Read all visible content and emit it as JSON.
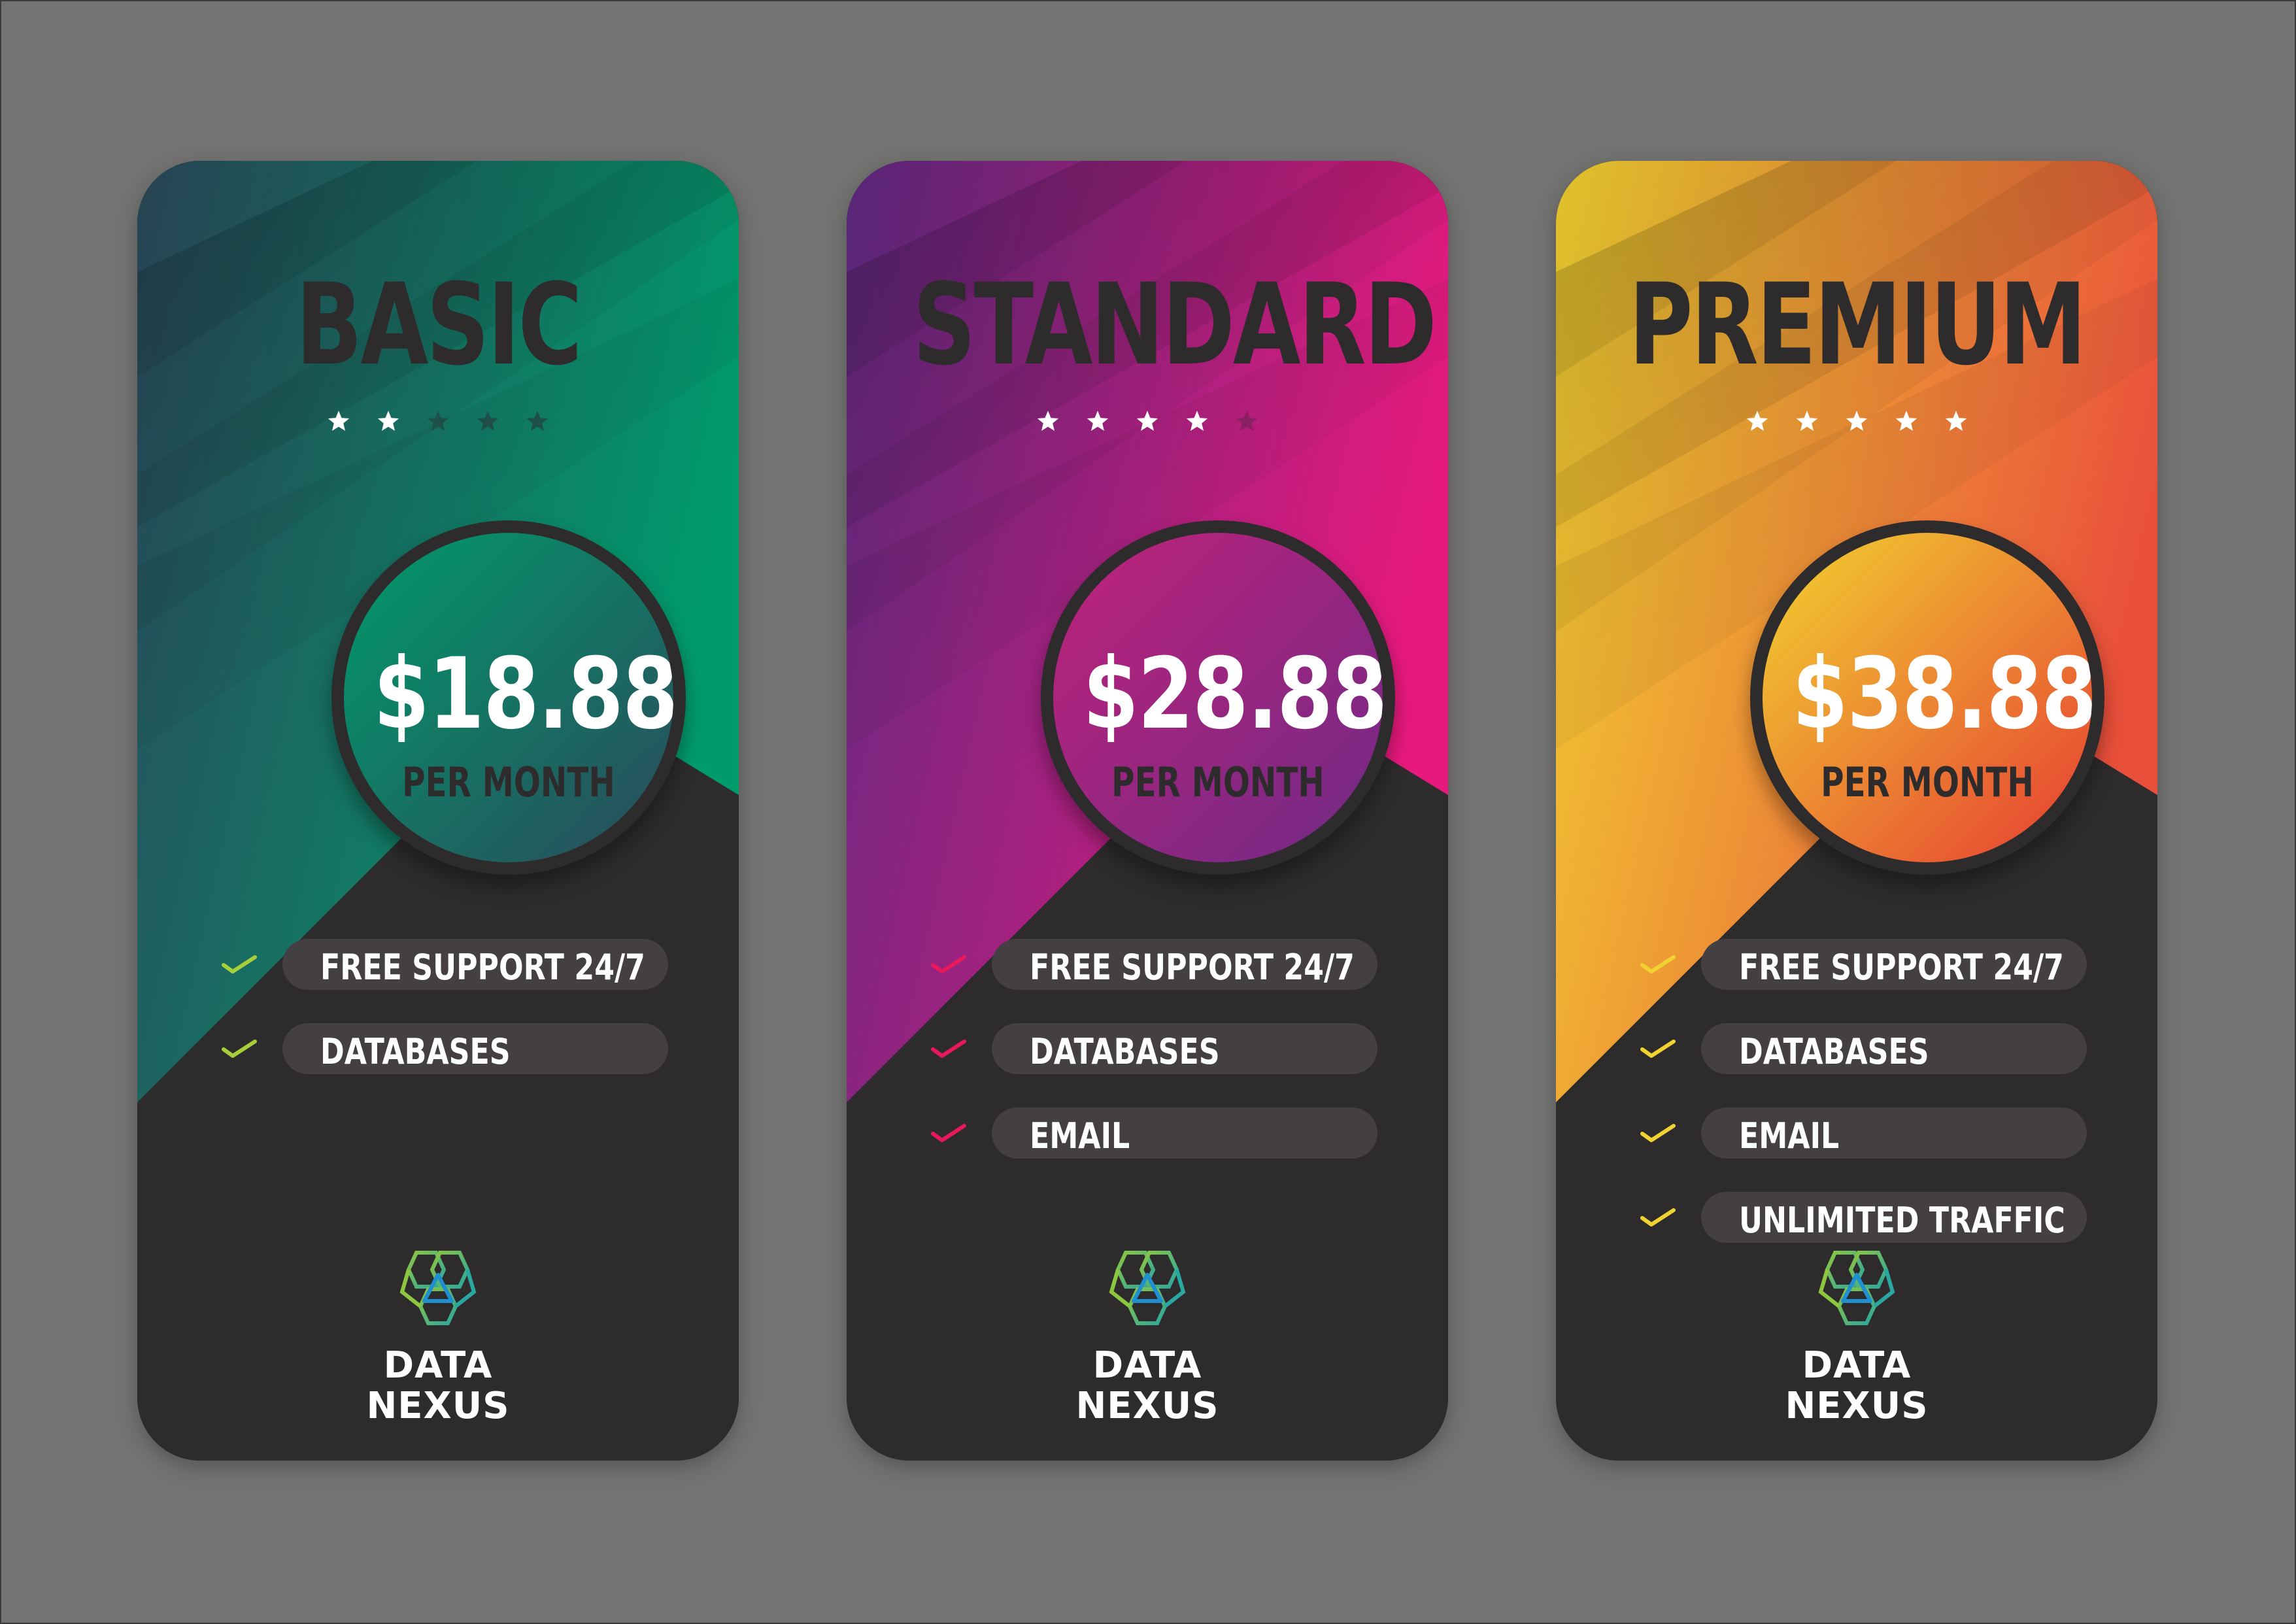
{
  "plans": [
    {
      "name": "BASIC",
      "stars_filled": 2,
      "stars_total": 5,
      "price": "$18.88",
      "period": "PER MONTH",
      "features": [
        "FREE SUPPORT 24/7",
        "DATABASES"
      ],
      "colors": {
        "start": "#2b4a5c",
        "end": "#009b6b",
        "check": "#a7cf3a",
        "circle_start": "#009b6b",
        "circle_end": "#2b4a5c",
        "star_on": "#ffffff",
        "star_off": "#1f4f4a"
      }
    },
    {
      "name": "STANDARD",
      "stars_filled": 4,
      "stars_total": 5,
      "price": "$28.88",
      "period": "PER MONTH",
      "features": [
        "FREE SUPPORT 24/7",
        "DATABASES",
        "EMAIL"
      ],
      "colors": {
        "start": "#5f2a82",
        "end": "#e8197d",
        "check": "#e8195a",
        "circle_start": "#c0227a",
        "circle_end": "#6f2a86",
        "star_on": "#ffffff",
        "star_off": "#8a2063"
      }
    },
    {
      "name": "PREMIUM",
      "stars_filled": 5,
      "stars_total": 5,
      "price": "$38.88",
      "period": "PER MONTH",
      "features": [
        "FREE SUPPORT 24/7",
        "DATABASES",
        "EMAIL",
        "UNLIMITED TRAFFIC"
      ],
      "colors": {
        "start": "#f2d330",
        "end": "#e9503b",
        "check": "#f0d232",
        "circle_start": "#f2d330",
        "circle_end": "#e63b33",
        "star_on": "#ffffff",
        "star_off": "#c07a2a"
      }
    }
  ],
  "logo": {
    "line1": "DATA",
    "line2": "NEXUS",
    "icon": "data-nexus-logo-icon",
    "colors": {
      "green": "#8dc63f",
      "teal": "#29a7a0",
      "blue": "#1f8fd0"
    }
  },
  "background": "#737372"
}
